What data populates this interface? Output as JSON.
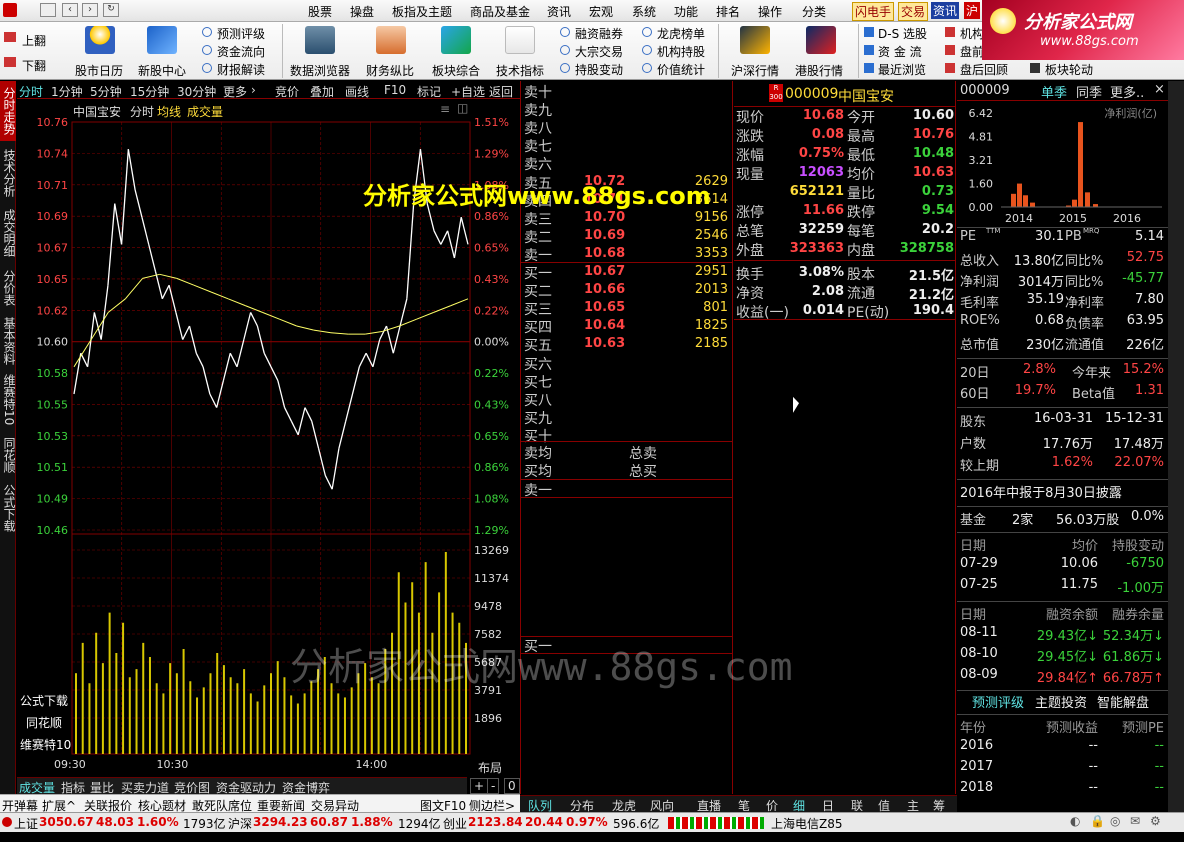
{
  "menu": {
    "items": [
      "股票",
      "操盘",
      "板指及主题",
      "商品及基金",
      "资讯",
      "宏观",
      "系统",
      "功能",
      "排名",
      "操作",
      "分类"
    ],
    "quick": [
      "闪电手",
      "交易",
      "资讯",
      "沪"
    ]
  },
  "toolbar": {
    "scroll_up": "上翻",
    "scroll_down": "下翻",
    "big": [
      "股市日历",
      "新股中心",
      "数据浏览器",
      "财务纵比",
      "板块综合",
      "技术指标",
      "沪深行情",
      "港股行情"
    ],
    "small1": [
      "预测评级",
      "资金流向",
      "财报解读"
    ],
    "small2": [
      "融资融券",
      "大宗交易",
      "持股变动"
    ],
    "small3": [
      "龙虎榜单",
      "机构持股",
      "价值统计"
    ],
    "small4": [
      "D-S 选股",
      "资 金 流",
      "最近浏览"
    ],
    "small5": [
      "机构",
      "盘前",
      "盘后回顾"
    ],
    "small6": [
      "板块轮动"
    ]
  },
  "logo": {
    "name": "分析家公式网",
    "url": "www.88gs.com"
  },
  "watermark1": "分析家公式网www.88gs.com",
  "watermark2": "分析家公式网www.88gs.com",
  "left_tabs": [
    "分时走势",
    "技术分析",
    "成交明细",
    "分价表",
    "基本资料",
    "维赛特10",
    "同花顺",
    "公式下载"
  ],
  "chart_tabs": [
    "分时",
    "1分钟",
    "5分钟",
    "15分钟",
    "30分钟",
    "更多",
    "竞价",
    "叠加",
    "画线",
    "F10",
    "标记",
    "+自选",
    "返回"
  ],
  "chart_header": {
    "name": "中国宝安",
    "mode": "分时",
    "avg": "均线",
    "vol": "成交量"
  },
  "chart_side_labels": [
    "公式下载",
    "同花顺",
    "维赛特10"
  ],
  "chart_data": {
    "type": "line",
    "time_labels": [
      "09:30",
      "10:30",
      "14:00"
    ],
    "price_axis": [
      "10.76",
      "10.74",
      "10.71",
      "10.69",
      "10.67",
      "10.65",
      "10.62",
      "10.60",
      "10.58",
      "10.55",
      "10.53",
      "10.51",
      "10.49",
      "10.46"
    ],
    "pct_axis": [
      "1.51%",
      "1.29%",
      "1.08%",
      "0.86%",
      "0.65%",
      "0.43%",
      "0.22%",
      "0.00%",
      "0.22%",
      "0.43%",
      "0.65%",
      "0.86%",
      "1.08%",
      "1.29%"
    ],
    "vol_axis": [
      "13269",
      "11374",
      "9478",
      "7582",
      "5687",
      "3791",
      "1896"
    ],
    "prev_close": 10.6,
    "ylim": [
      10.46,
      10.76
    ],
    "price": [
      10.56,
      10.59,
      10.58,
      10.62,
      10.6,
      10.64,
      10.7,
      10.67,
      10.74,
      10.71,
      10.69,
      10.67,
      10.65,
      10.63,
      10.64,
      10.62,
      10.6,
      10.61,
      10.59,
      10.58,
      10.56,
      10.55,
      10.57,
      10.59,
      10.58,
      10.6,
      10.62,
      10.61,
      10.59,
      10.58,
      10.57,
      10.55,
      10.54,
      10.53,
      10.55,
      10.54,
      10.52,
      10.5,
      10.49,
      10.52,
      10.54,
      10.56,
      10.58,
      10.59,
      10.58,
      10.6,
      10.61,
      10.59,
      10.61,
      10.63,
      10.7,
      10.74,
      10.7,
      10.68,
      10.67,
      10.68,
      10.66,
      10.69,
      10.67
    ],
    "avg": [
      10.58,
      10.6,
      10.62,
      10.63,
      10.645,
      10.648,
      10.645,
      10.64,
      10.635,
      10.63,
      10.625,
      10.62,
      10.615,
      10.61,
      10.607,
      10.605,
      10.604,
      10.604,
      10.606,
      10.61,
      10.615,
      10.62,
      10.625,
      10.63
    ],
    "volume": [
      40,
      55,
      35,
      60,
      45,
      70,
      50,
      65,
      38,
      42,
      55,
      48,
      35,
      30,
      45,
      40,
      52,
      36,
      28,
      33,
      40,
      50,
      44,
      38,
      35,
      42,
      30,
      26,
      34,
      40,
      46,
      38,
      29,
      25,
      30,
      36,
      42,
      48,
      35,
      30,
      28,
      33,
      40,
      45,
      38,
      35,
      52,
      60,
      90,
      75,
      85,
      70,
      95,
      60,
      80,
      100,
      70,
      65,
      55
    ],
    "range_labels": [
      "布局",
      "+",
      "-",
      "0"
    ]
  },
  "chart_footer_tabs": [
    "成交量",
    "指标",
    "量比",
    "买卖力道",
    "竞价图",
    "资金驱动力",
    "资金博弈"
  ],
  "order_book": {
    "sell_labels": [
      "卖十",
      "卖九",
      "卖八",
      "卖七",
      "卖六",
      "卖五",
      "卖四",
      "卖三",
      "卖二",
      "卖一"
    ],
    "sell_prices": [
      "",
      "",
      "",
      "",
      "",
      "10.72",
      "10.71",
      "10.70",
      "10.69",
      "10.68"
    ],
    "sell_vols": [
      "",
      "",
      "",
      "",
      "",
      "2629",
      "3614",
      "9156",
      "2546",
      "3353"
    ],
    "buy_labels": [
      "买一",
      "买二",
      "买三",
      "买四",
      "买五",
      "买六",
      "买七",
      "买八",
      "买九",
      "买十"
    ],
    "buy_prices": [
      "10.67",
      "10.66",
      "10.65",
      "10.64",
      "10.63",
      "",
      "",
      "",
      "",
      ""
    ],
    "buy_vols": [
      "2951",
      "2013",
      "801",
      "1825",
      "2185",
      "",
      "",
      "",
      "",
      ""
    ],
    "avg_sell": "卖均",
    "avg_buy": "买均",
    "total_sell": "总卖",
    "total_buy": "总买",
    "sell1": "卖一",
    "buy1": "买一"
  },
  "quote": {
    "code": "000009",
    "name": "中国宝安",
    "badge_r": "R",
    "badge_300": "300",
    "rows": [
      [
        "现价",
        "10.68",
        "今开",
        "10.60"
      ],
      [
        "涨跌",
        "0.08",
        "最高",
        "10.76"
      ],
      [
        "涨幅",
        "0.75%",
        "最低",
        "10.48"
      ],
      [
        "现量",
        "12063",
        "均价",
        "10.63"
      ],
      [
        "",
        "652121",
        "量比",
        "0.73"
      ],
      [
        "涨停",
        "11.66",
        "跌停",
        "9.54"
      ],
      [
        "总笔",
        "32259",
        "每笔",
        "20.2"
      ],
      [
        "外盘",
        "323363",
        "内盘",
        "328758"
      ],
      [
        "换手",
        "3.08%",
        "股本",
        "21.5亿"
      ],
      [
        "净资",
        "2.08",
        "流通",
        "21.2亿"
      ],
      [
        "收益(一)",
        "0.014",
        "PE(动)",
        "190.4"
      ]
    ]
  },
  "right_tabs": [
    "队列",
    "分布",
    "龙虎",
    "风向",
    "直播",
    "笔",
    "价",
    "细",
    "日",
    "联",
    "值",
    "主",
    "筹"
  ],
  "fin": {
    "code": "000009",
    "tab1": "单季",
    "tab2": "同季",
    "more": "更多..",
    "close": "×",
    "yaxis": [
      "6.42",
      "4.81",
      "3.21",
      "1.60",
      "0.00"
    ],
    "years": [
      "2014",
      "2015",
      "2016"
    ],
    "legend": "净利润(亿)",
    "bars": [
      0.9,
      1.6,
      0.8,
      0.3,
      0.1,
      0.5,
      5.8,
      1.0,
      0.2
    ],
    "rows": [
      [
        "PE",
        "TTM",
        "30.1",
        "PB",
        "MRQ",
        "5.14"
      ],
      [
        "总收入",
        "",
        "13.80亿",
        "同比%",
        "",
        "52.75"
      ],
      [
        "净利润",
        "",
        "3014万",
        "同比%",
        "",
        "-45.77"
      ],
      [
        "毛利率",
        "",
        "35.19",
        "净利率",
        "",
        "7.80"
      ],
      [
        "ROE%",
        "",
        "0.68",
        "负债率",
        "",
        "63.95"
      ],
      [
        "总市值",
        "",
        "230亿",
        "流通值",
        "",
        "226亿"
      ]
    ],
    "perf": [
      [
        "20日",
        "2.8%",
        "今年来",
        "15.2%"
      ],
      [
        "60日",
        "19.7%",
        "Beta值",
        "1.31"
      ]
    ],
    "holder": [
      [
        "股东",
        "16-03-31",
        "15-12-31"
      ],
      [
        "户数",
        "17.76万",
        "17.48万"
      ],
      [
        "较上期",
        "1.62%",
        "22.07%"
      ]
    ],
    "report": "2016年中报于8月30日披露",
    "fund": [
      "基金",
      "2家",
      "56.03万股",
      "0.0%"
    ],
    "hold_hdr": [
      "日期",
      "均价",
      "持股变动"
    ],
    "hold": [
      [
        "07-29",
        "10.06",
        "-6750"
      ],
      [
        "07-25",
        "11.75",
        "-1.00万"
      ]
    ],
    "margin_hdr": [
      "日期",
      "融资余额",
      "融券余量"
    ],
    "margin": [
      [
        "08-11",
        "29.43亿↓",
        "52.34万↓"
      ],
      [
        "08-10",
        "29.45亿↓",
        "61.86万↓"
      ],
      [
        "08-09",
        "29.84亿↑",
        "66.78万↑"
      ]
    ],
    "tabs3": [
      "预测评级",
      "主题投资",
      "智能解盘"
    ],
    "fc_hdr": [
      "年份",
      "预测收益",
      "预测PE"
    ],
    "fc": [
      [
        "2016",
        "--",
        "--"
      ],
      [
        "2017",
        "--",
        "--"
      ],
      [
        "2018",
        "--",
        "--"
      ]
    ]
  },
  "bottom_tabs": [
    "开弹幕",
    "扩展^",
    "关联报价",
    "核心题材",
    "敢死队席位",
    "重要新闻",
    "交易异动",
    "图文F10",
    "侧边栏>"
  ],
  "status": {
    "sh_label": "上证",
    "sh": "3050.67",
    "sh_chg": "48.03",
    "sh_pct": "1.60%",
    "sh_amt": "1793亿",
    "hs_label": "沪深",
    "hs": "3294.23",
    "hs_chg": "60.87",
    "hs_pct": "1.88%",
    "hs_amt": "1294亿",
    "cy_label": "创业",
    "cy": "2123.84",
    "cy_chg": "20.44",
    "cy_pct": "0.97%",
    "cy_amt": "596.6亿",
    "server": "上海电信Z85"
  },
  "colors": {
    "up": "#ff4545",
    "down": "#3bd23b",
    "grid": "#800000",
    "price_line": "#ffffff",
    "avg_line": "#ffff66",
    "vol": "#d8c800"
  }
}
